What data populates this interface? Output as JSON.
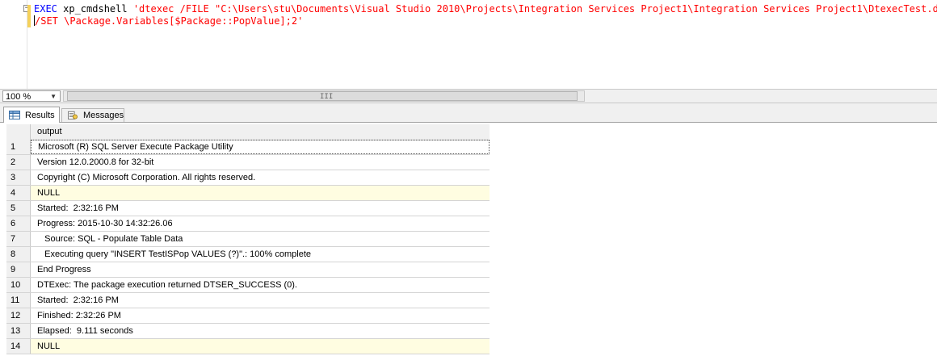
{
  "editor": {
    "line1": {
      "keyword": "EXEC",
      "proc": " xp_cmdshell ",
      "string": "'dtexec /FILE \"C:\\Users\\stu\\Documents\\Visual Studio 2010\\Projects\\Integration Services Project1\\Integration Services Project1\\DtexecTest.dtsx\""
    },
    "line2": {
      "string": "/SET \\Package.Variables[$Package::PopValue];2'"
    },
    "collapse_glyph": "−"
  },
  "zoom": {
    "value": "100 %",
    "dropdown_glyph": "▼"
  },
  "scrollbar": {
    "grip_glyph": "III"
  },
  "tabs": {
    "results": "Results",
    "messages": "Messages"
  },
  "grid": {
    "column_header": "output",
    "rows": [
      {
        "num": "1",
        "value": "Microsoft (R) SQL Server Execute Package Utility"
      },
      {
        "num": "2",
        "value": "Version 12.0.2000.8 for 32-bit"
      },
      {
        "num": "3",
        "value": "Copyright (C) Microsoft Corporation. All rights reserved."
      },
      {
        "num": "4",
        "value": "NULL"
      },
      {
        "num": "5",
        "value": "Started:  2:32:16 PM"
      },
      {
        "num": "6",
        "value": "Progress: 2015-10-30 14:32:26.06"
      },
      {
        "num": "7",
        "value": "   Source: SQL - Populate Table Data"
      },
      {
        "num": "8",
        "value": "   Executing query \"INSERT TestISPop VALUES (?)\".: 100% complete"
      },
      {
        "num": "9",
        "value": "End Progress"
      },
      {
        "num": "10",
        "value": "DTExec: The package execution returned DTSER_SUCCESS (0)."
      },
      {
        "num": "11",
        "value": "Started:  2:32:16 PM"
      },
      {
        "num": "12",
        "value": "Finished: 2:32:26 PM"
      },
      {
        "num": "13",
        "value": "Elapsed:  9.111 seconds"
      },
      {
        "num": "14",
        "value": "NULL"
      }
    ]
  },
  "colors": {
    "null_cell": "#fffde1",
    "keyword": "#0000ff",
    "string": "#ff0000",
    "change_marker": "#f5d15a"
  }
}
